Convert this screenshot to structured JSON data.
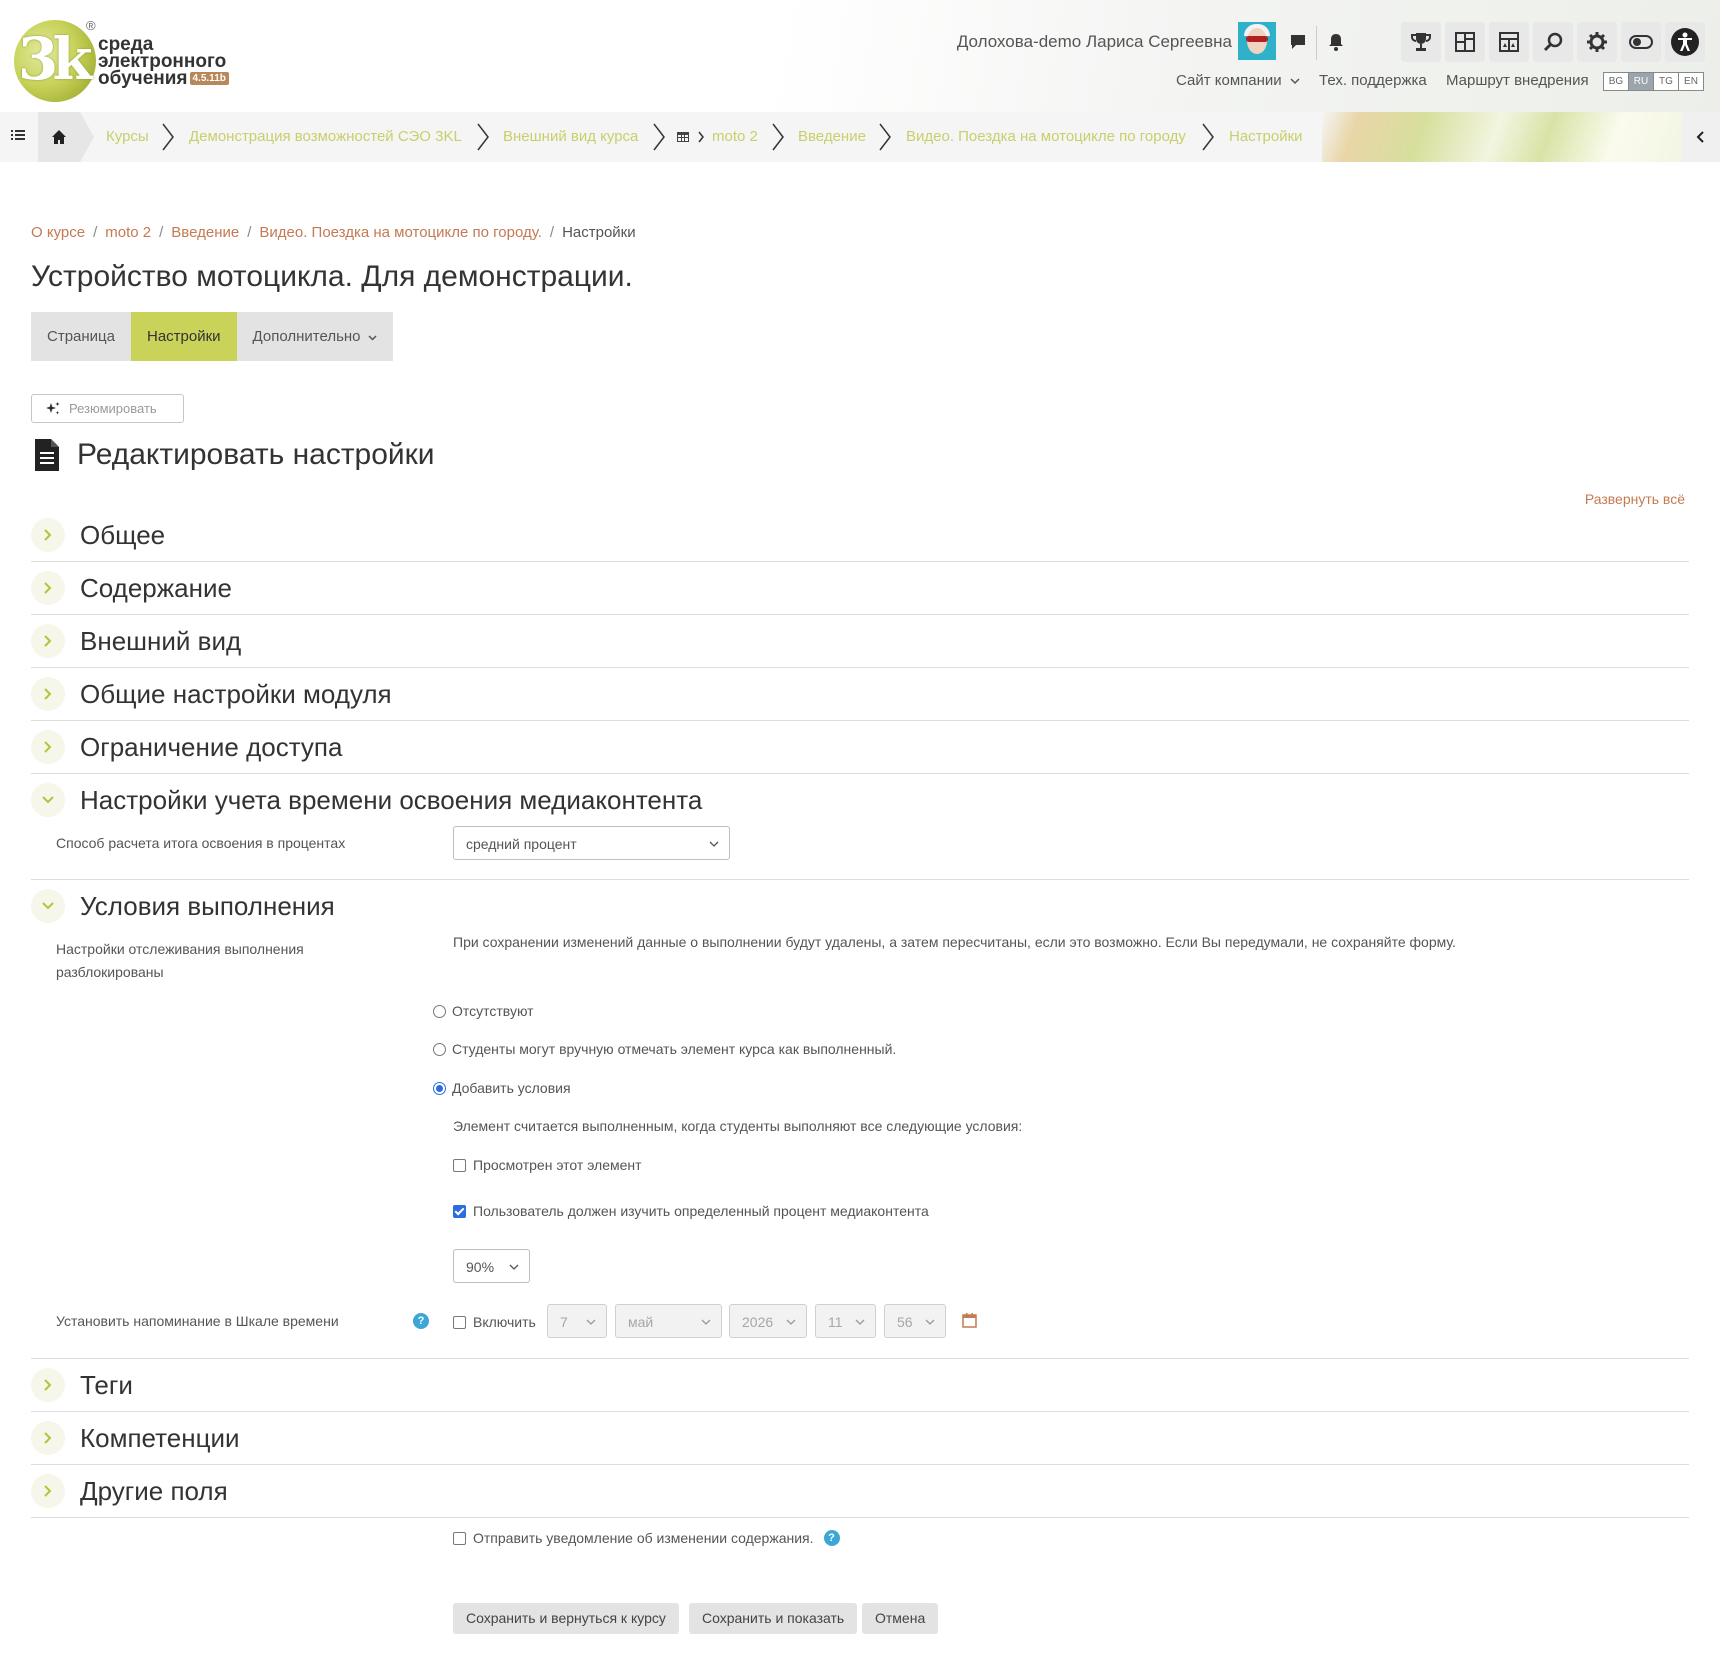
{
  "header": {
    "logo_line1": "среда",
    "logo_line2": "электронного",
    "logo_line3": "обучения",
    "logo_version": "4.5.11b",
    "logo_mark": "3k",
    "user_name": "Долохова-demo Лариса Сергеевна",
    "nav": {
      "company_site": "Сайт компании",
      "support": "Тех. поддержка",
      "route": "Маршрут внедрения"
    },
    "languages": [
      "BG",
      "RU",
      "TG",
      "EN"
    ],
    "active_language": "RU"
  },
  "breadcrumb_bar": {
    "items": [
      "Курсы",
      "Демонстрация возможностей СЭО 3KL",
      "Внешний вид курса",
      "moto 2",
      "Введение",
      "Видео. Поездка на мотоцикле по городу",
      "Настройки"
    ],
    "accent_color": "#c9cf6a"
  },
  "page": {
    "crumbs": [
      "О курсе",
      "moto 2",
      "Введение",
      "Видео. Поездка на мотоцикле по городу.",
      "Настройки"
    ],
    "title": "Устройство мотоцикла. Для демонстрации.",
    "tabs": [
      "Страница",
      "Настройки",
      "Дополнительно"
    ],
    "active_tab": "Настройки",
    "summarize_label": "Резюмировать",
    "edit_heading": "Редактировать настройки",
    "expand_all": "Развернуть всё"
  },
  "sections": {
    "general": "Общее",
    "content": "Содержание",
    "appearance": "Внешний вид",
    "module_common": "Общие настройки модуля",
    "access": "Ограничение доступа",
    "media": "Настройки учета времени освоения медиаконтента",
    "completion": "Условия выполнения",
    "tags": "Теги",
    "competencies": "Компетенции",
    "other_fields": "Другие поля"
  },
  "media_settings": {
    "calc_label": "Способ расчета итога освоения в процентах",
    "calc_value": "средний процент"
  },
  "completion": {
    "unlocked_label": "Настройки отслеживания выполнения разблокированы",
    "warning": "При сохранении изменений данные о выполнении будут удалены, а затем пересчитаны, если это возможно. Если Вы передумали, не сохраняйте форму.",
    "radio_none": "Отсутствуют",
    "radio_manual": "Студенты могут вручную отмечать элемент курса как выполненный.",
    "radio_conditions": "Добавить условия",
    "selected_radio": "Добавить условия",
    "conditions_intro": "Элемент считается выполненным, когда студенты выполняют все следующие условия:",
    "cb_viewed": "Просмотрен этот элемент",
    "cb_viewed_checked": false,
    "cb_media": "Пользователь должен изучить определенный процент медиаконтента",
    "cb_media_checked": true,
    "percent_value": "90%",
    "reminder_label": "Установить напоминание в Шкале времени",
    "reminder_enable": "Включить",
    "reminder_enabled": false,
    "reminder_day": "7",
    "reminder_month": "май",
    "reminder_year": "2026",
    "reminder_hour": "11",
    "reminder_minute": "56"
  },
  "footer": {
    "notify_label": "Отправить уведомление об изменении содержания.",
    "notify_checked": false,
    "save_return": "Сохранить и вернуться к курсу",
    "save_show": "Сохранить и показать",
    "cancel": "Отмена"
  },
  "colors": {
    "accent_green": "#c9d35a",
    "link_orange": "#c47a52",
    "help_blue": "#3ca7d6",
    "check_blue": "#2d6be0"
  }
}
